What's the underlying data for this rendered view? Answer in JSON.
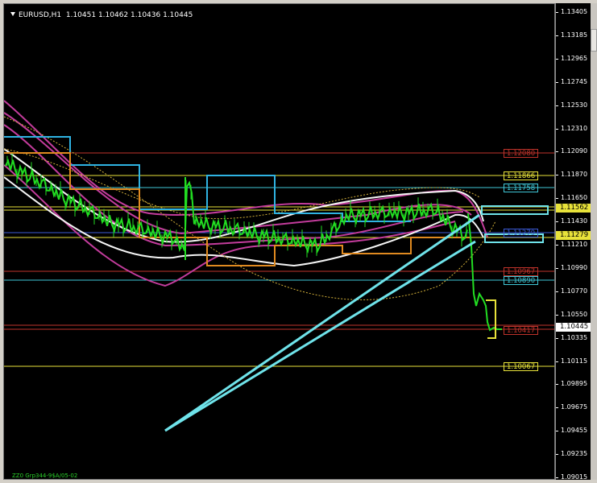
{
  "header": {
    "symbol": "EURUSD,H1",
    "ohlc": "1.10451 1.10462 1.10436 1.10445"
  },
  "footer": {
    "note": "ZZ0 Grp344-9$A/05-02"
  },
  "price_axis": {
    "ticks": [
      "1.13405",
      "1.13185",
      "1.12965",
      "1.12745",
      "1.12530",
      "1.12310",
      "1.12090",
      "1.11870",
      "1.11650",
      "1.11430",
      "1.11210",
      "1.10990",
      "1.10770",
      "1.10550",
      "1.10335",
      "1.10115",
      "1.09895",
      "1.09675",
      "1.09455",
      "1.09235",
      "1.09015"
    ],
    "current_price": "1.10445"
  },
  "levels": [
    {
      "label": "1.12080",
      "color": "#c0332b"
    },
    {
      "label": "1.11866",
      "color": "#e8e23a"
    },
    {
      "label": "1.11758",
      "color": "#40c8d8"
    },
    {
      "label": "1.11279",
      "color": "#e8e23a"
    },
    {
      "label": "1.11000",
      "color": "#3b5bd6"
    },
    {
      "label": "1.10967",
      "color": "#c0332b"
    },
    {
      "label": "1.10890",
      "color": "#40c8d8"
    },
    {
      "label": "1.10417",
      "color": "#c0332b"
    },
    {
      "label": "1.10067",
      "color": "#e8e23a"
    }
  ],
  "side_labels": [
    "1.11562",
    "1.11279"
  ],
  "colors": {
    "background": "#000000",
    "candles": "#22dd22",
    "arrows": "#6fe3ea"
  }
}
